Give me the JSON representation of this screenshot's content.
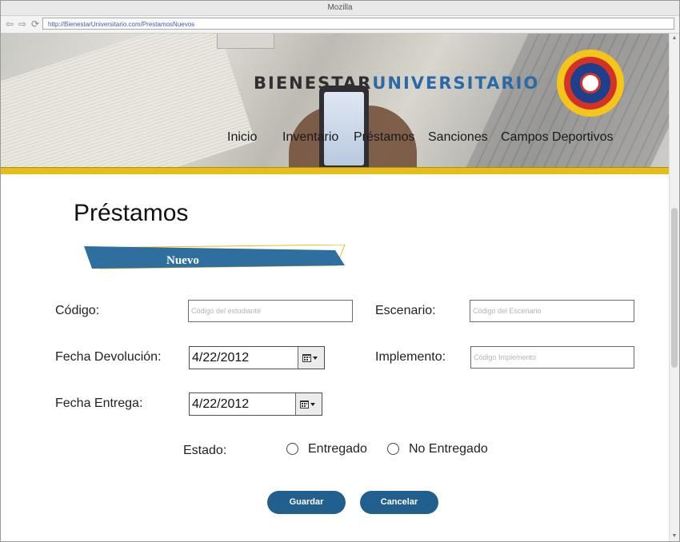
{
  "browser": {
    "title": "Mozilla",
    "url": "http://BienestarUniversitario.com/PrestamosNuevos"
  },
  "header": {
    "logo_part1": "BIENESTAR",
    "logo_part2": "UNIVERSITARIO",
    "menu": [
      "Inicio",
      "Inventario",
      "Préstamos",
      "Sanciones",
      "Campos Deportivos"
    ]
  },
  "page": {
    "title": "Préstamos",
    "ribbon_label": "Nuevo"
  },
  "form": {
    "codigo_label": "Código:",
    "codigo_placeholder": "Código del estudiante",
    "escenario_label": "Escenario:",
    "escenario_placeholder": "Código del Escenario",
    "fecha_devolucion_label": "Fecha Devolución:",
    "fecha_devolucion_value": "4/22/2012",
    "implemento_label": "Implemento:",
    "implemento_placeholder": "Código Implemento",
    "fecha_entrega_label": "Fecha Entrega:",
    "fecha_entrega_value": "4/22/2012",
    "estado_label": "Estado:",
    "estado_options": [
      "Entregado",
      "No Entregado"
    ]
  },
  "buttons": {
    "save": "Guardar",
    "cancel": "Cancelar"
  },
  "colors": {
    "accent": "#215f8e",
    "gold": "#e7bd1a",
    "logo_blue": "#2a6aa6"
  }
}
